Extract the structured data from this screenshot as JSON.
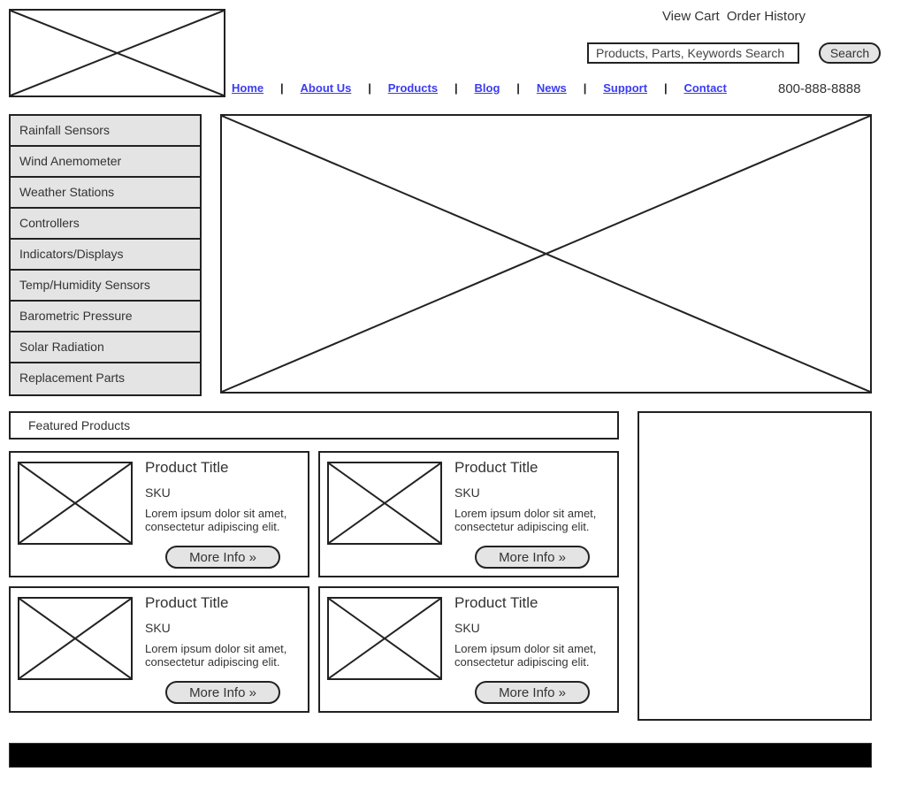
{
  "header": {
    "logo_alt": "Company Logo",
    "account_links": [
      "View Cart",
      "Order History"
    ],
    "search": {
      "placeholder": "Products, Parts, Keywords Search",
      "value": "",
      "button_label": "Search"
    },
    "nav_items": [
      {
        "label": "Home"
      },
      {
        "label": "About Us"
      },
      {
        "label": "Products"
      },
      {
        "label": "Blog"
      },
      {
        "label": "News"
      },
      {
        "label": "Support"
      },
      {
        "label": "Contact"
      }
    ],
    "nav_separator": "|",
    "phone": "800-888-8888"
  },
  "sidebar": {
    "items": [
      {
        "label": "Rainfall Sensors"
      },
      {
        "label": "Wind Anemometer"
      },
      {
        "label": "Weather Stations"
      },
      {
        "label": "Controllers"
      },
      {
        "label": "Indicators/Displays"
      },
      {
        "label": "Temp/Humidity Sensors"
      },
      {
        "label": "Barometric Pressure"
      },
      {
        "label": "Solar Radiation"
      },
      {
        "label": "Replacement Parts"
      }
    ]
  },
  "hero": {
    "alt": "Hero Banner Image Placeholder"
  },
  "featured": {
    "heading": "Featured Products",
    "products": [
      {
        "title": "Product Title",
        "sku": "SKU",
        "description": "Lorem ipsum dolor sit amet, consectetur adipiscing elit.",
        "button_label": "More Info »",
        "image_alt": "Product Image Placeholder"
      },
      {
        "title": "Product Title",
        "sku": "SKU",
        "description": "Lorem ipsum dolor sit amet, consectetur adipiscing elit.",
        "button_label": "More Info »",
        "image_alt": "Product Image Placeholder"
      },
      {
        "title": "Product Title",
        "sku": "SKU",
        "description": "Lorem ipsum dolor sit amet, consectetur adipiscing elit.",
        "button_label": "More Info »",
        "image_alt": "Product Image Placeholder"
      },
      {
        "title": "Product Title",
        "sku": "SKU",
        "description": "Lorem ipsum dolor sit amet, consectetur adipiscing elit.",
        "button_label": "More Info »",
        "image_alt": "Product Image Placeholder"
      }
    ]
  },
  "ad_panel": {
    "alt": "Empty Promotional Panel"
  },
  "footer": {
    "alt": "Footer Bar"
  },
  "colors": {
    "link": "#3b3bf0",
    "outline": "#222222",
    "fill_gray": "#e4e4e4",
    "text": "#333333",
    "footer": "#000000"
  }
}
